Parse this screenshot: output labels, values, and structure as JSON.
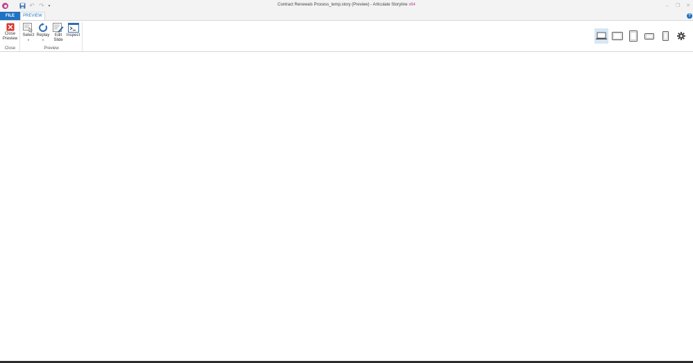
{
  "titlebar": {
    "title": "Contract Renewals Process_temp.story (Preview) -  Articulate Storyline",
    "bits": "x64",
    "icons": [
      "storyline-app-icon",
      "save-icon",
      "undo-icon",
      "redo-icon",
      "customize-quick-access-icon",
      "minimize-icon",
      "maximize-icon",
      "close-window-icon"
    ]
  },
  "tabs": {
    "file": "FILE",
    "preview": "PREVIEW",
    "help": "?"
  },
  "ribbon": {
    "groups": {
      "close": "Close",
      "preview": "Preview"
    },
    "close_preview": {
      "line1": "Close",
      "line2": "Preview"
    },
    "select": {
      "label": "Select",
      "caret": "▾"
    },
    "replay": {
      "label": "Replay",
      "caret": "▾"
    },
    "edit_slide": {
      "line1": "Edit",
      "line2": "Slide"
    },
    "inspect": {
      "label": "Inspect"
    },
    "devices": [
      "desktop-icon",
      "tablet-landscape-icon",
      "tablet-portrait-icon",
      "phone-landscape-icon",
      "phone-portrait-icon",
      "settings-gear-icon"
    ]
  },
  "colors": {
    "accent": "#1f73c1",
    "brand": "#c0468f",
    "close_red": "#d9342b",
    "active_device_bg": "#d6e6f5"
  }
}
